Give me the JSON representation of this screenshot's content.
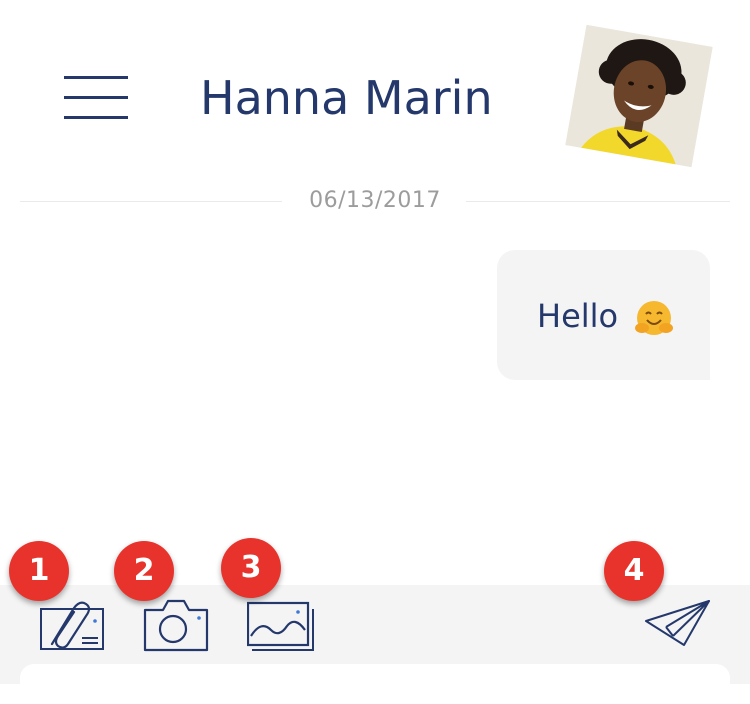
{
  "header": {
    "title": "Hanna Marin"
  },
  "conversation": {
    "date": "06/13/2017",
    "messages": [
      {
        "text": "Hello",
        "emoji": "hugging-face-icon"
      }
    ]
  },
  "composer": {
    "tools": [
      {
        "icon": "attachment-icon",
        "badge": "1"
      },
      {
        "icon": "camera-icon",
        "badge": "2"
      },
      {
        "icon": "gallery-icon",
        "badge": "3"
      },
      {
        "icon": "send-icon",
        "badge": "4"
      }
    ]
  },
  "colors": {
    "primary": "#24386b",
    "badge": "#e8332c",
    "bubble": "#f4f4f5",
    "composer": "#f4f4f5"
  }
}
